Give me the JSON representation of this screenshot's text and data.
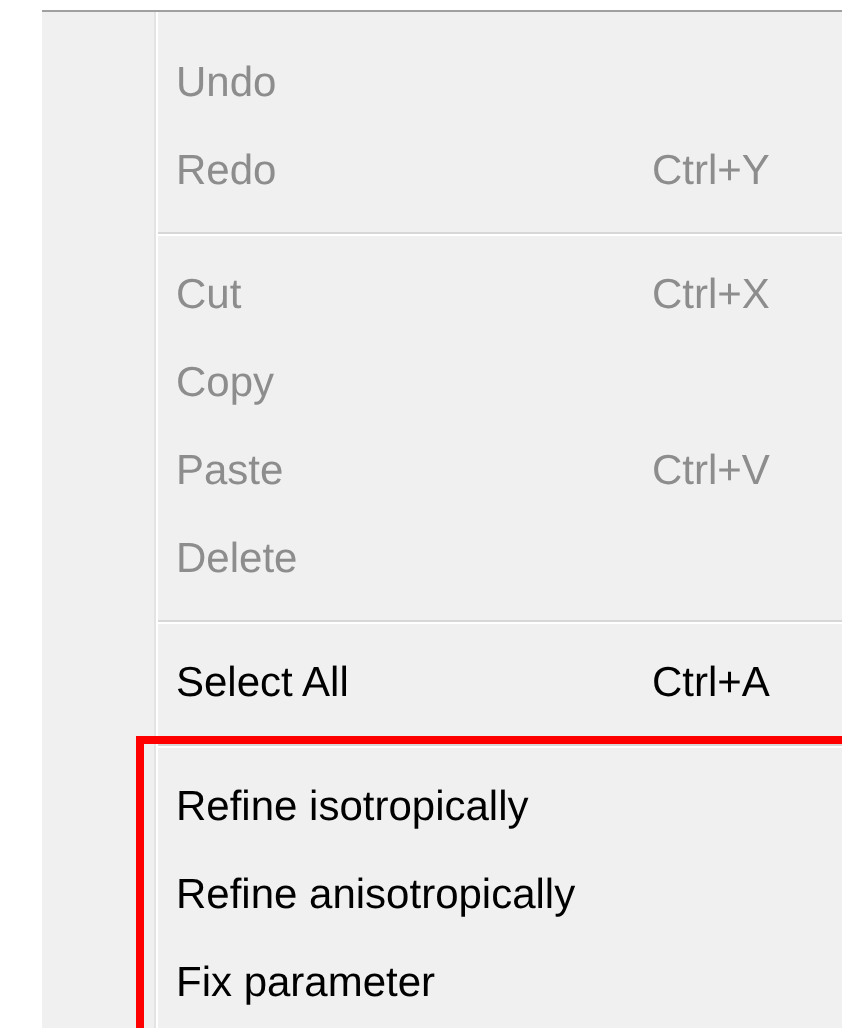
{
  "menu": {
    "sections": [
      {
        "highlighted": false,
        "items": [
          {
            "label": "Undo",
            "disabled": true
          },
          {
            "label": "Redo",
            "shortcut": "Ctrl+Y",
            "disabled": true
          }
        ]
      },
      {
        "highlighted": false,
        "items": [
          {
            "label": "Cut",
            "shortcut": "Ctrl+X",
            "disabled": true
          },
          {
            "label": "Copy",
            "disabled": true
          },
          {
            "label": "Paste",
            "shortcut": "Ctrl+V",
            "disabled": true
          },
          {
            "label": "Delete",
            "disabled": true
          }
        ]
      },
      {
        "highlighted": false,
        "items": [
          {
            "label": "Select All",
            "shortcut": "Ctrl+A",
            "disabled": false
          }
        ]
      },
      {
        "highlighted": true,
        "items": [
          {
            "label": "Refine isotropically",
            "disabled": false
          },
          {
            "label": "Refine anisotropically",
            "disabled": false
          },
          {
            "label": "Fix parameter",
            "disabled": false
          }
        ]
      }
    ]
  }
}
